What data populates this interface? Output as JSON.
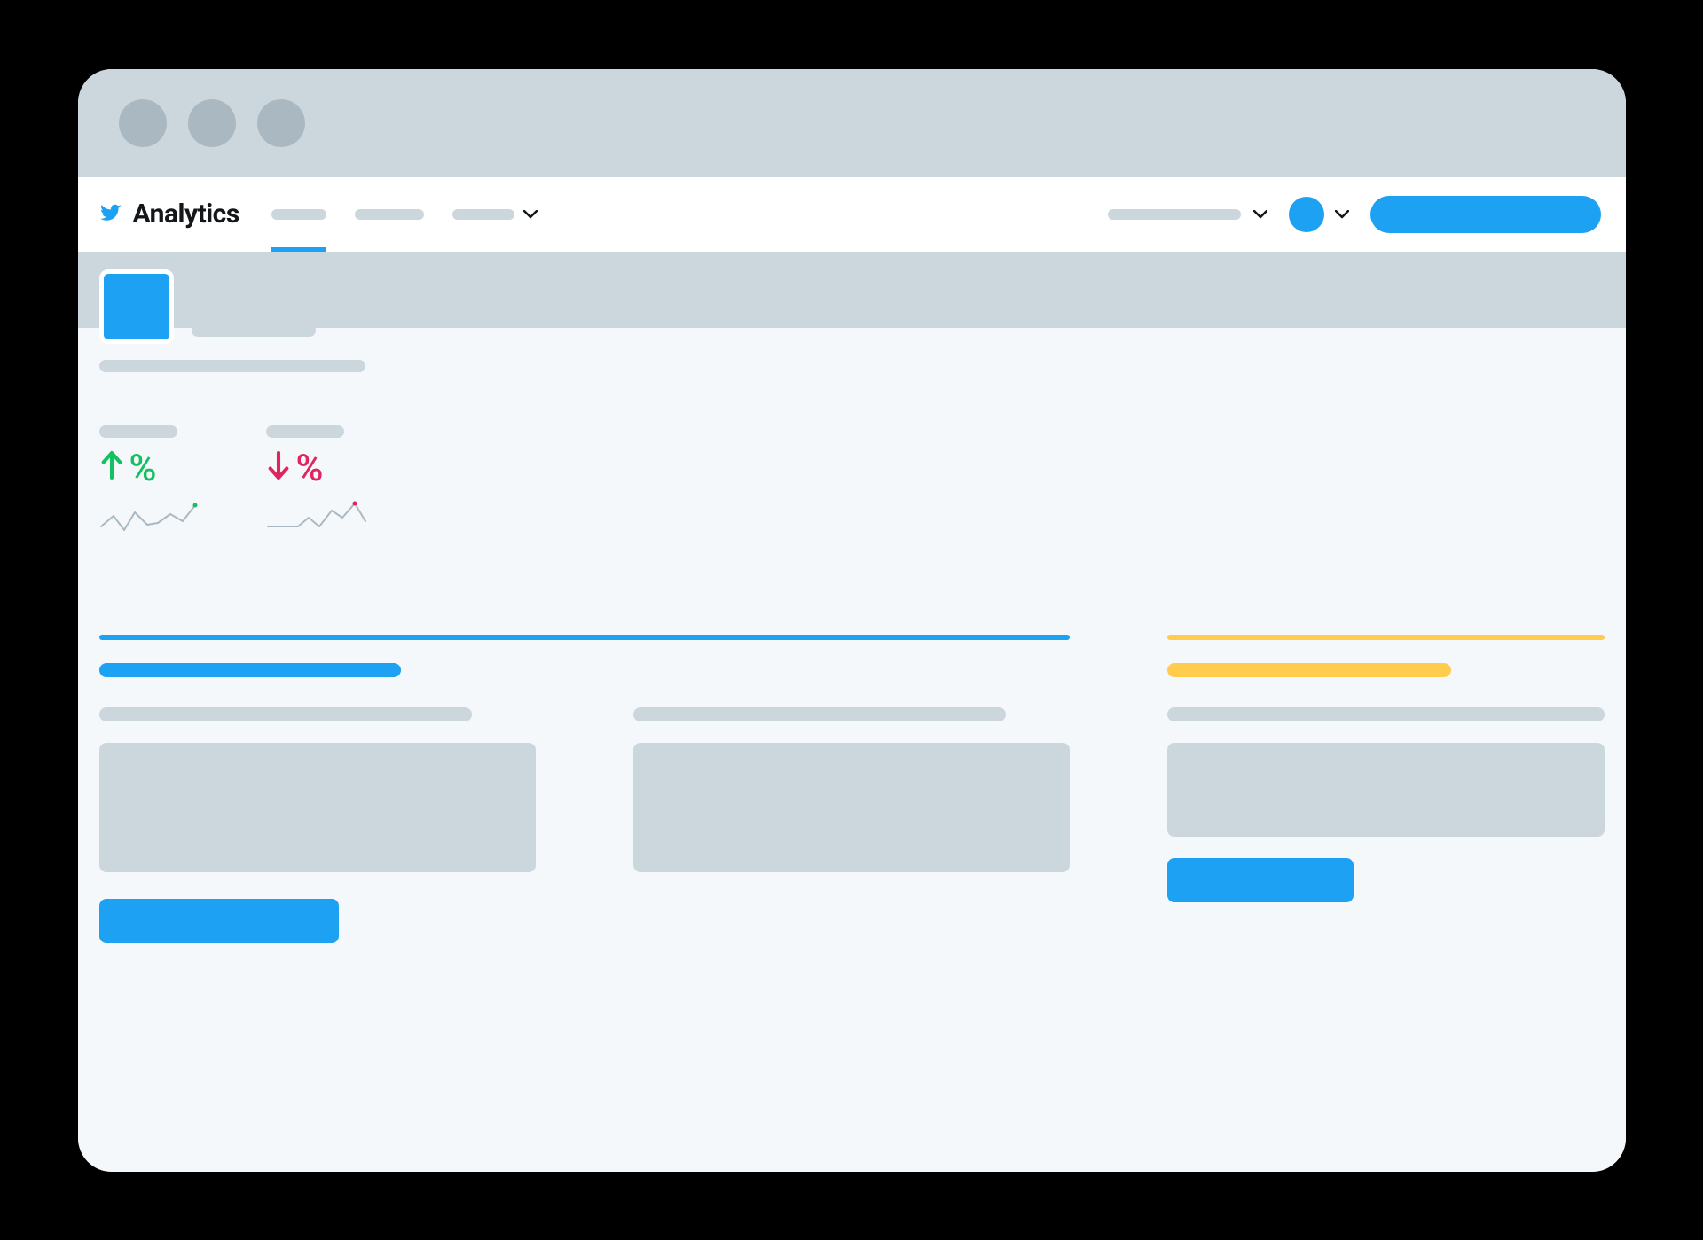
{
  "brand": {
    "title": "Analytics"
  },
  "nav": {
    "tabs": [
      {
        "id": "home",
        "active": true
      },
      {
        "id": "tweets",
        "active": false
      },
      {
        "id": "more",
        "active": false,
        "has_caret": true
      }
    ]
  },
  "metrics": [
    {
      "direction": "up",
      "symbol": "%",
      "color": "#17bf63",
      "sparkline": [
        10,
        14,
        8,
        20,
        12,
        14,
        22,
        16,
        26
      ]
    },
    {
      "direction": "down",
      "symbol": "%",
      "color": "#e0245e",
      "sparkline": [
        12,
        12,
        12,
        12,
        18,
        12,
        24,
        20,
        30,
        22
      ]
    }
  ],
  "cards": {
    "summary": {
      "accent": "blue"
    },
    "tips": {
      "accent": "yellow"
    }
  },
  "colors": {
    "primary": "#1da1f2",
    "up": "#17bf63",
    "down": "#e0245e",
    "highlight": "#ffcc4d",
    "muted": "#ccd6dd",
    "bg": "#f5f8fa"
  }
}
